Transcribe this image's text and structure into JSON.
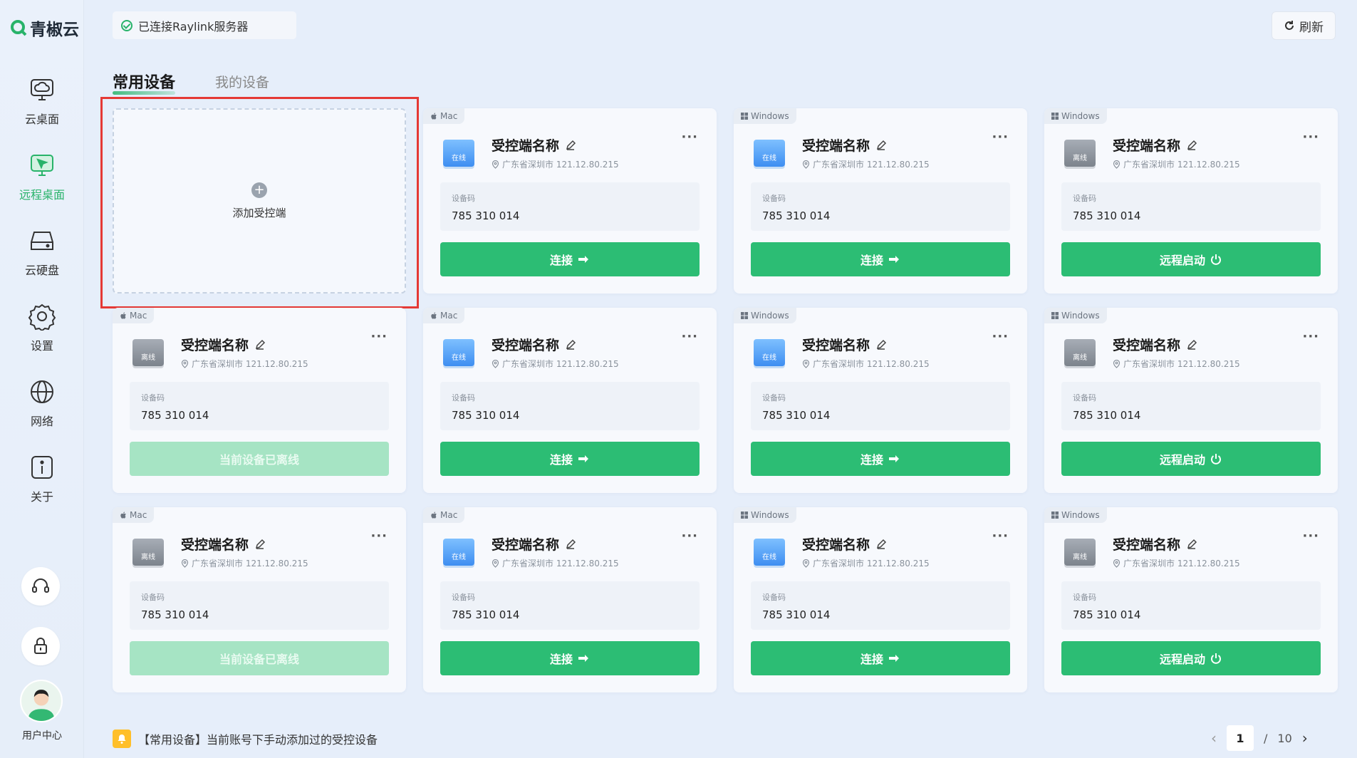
{
  "app": {
    "logo_text": "青椒云"
  },
  "sidebar": {
    "items": [
      {
        "label": "云桌面",
        "icon": "cloud-desktop-icon"
      },
      {
        "label": "远程桌面",
        "icon": "remote-desktop-icon"
      },
      {
        "label": "云硬盘",
        "icon": "cloud-disk-icon"
      },
      {
        "label": "设置",
        "icon": "gear-icon"
      },
      {
        "label": "网络",
        "icon": "globe-icon"
      },
      {
        "label": "关于",
        "icon": "info-icon"
      }
    ],
    "user_center": "用户中心"
  },
  "topbar": {
    "connection_status": "已连接Raylink服务器",
    "refresh_label": "刷新"
  },
  "tabs": {
    "active": "常用设备",
    "inactive": "我的设备"
  },
  "add_tile": {
    "label": "添加受控端"
  },
  "colors": {
    "accent": "#2cbd74",
    "accent_disabled": "#a6e4c4",
    "highlight": "#e53935"
  },
  "devices": [
    {
      "os": "Mac",
      "status": "在线",
      "name": "受控端名称",
      "location": "广东省深圳市 121.12.80.215",
      "code_label": "设备码",
      "code": "785 310 014",
      "action": "连接"
    },
    {
      "os": "Windows",
      "status": "在线",
      "name": "受控端名称",
      "location": "广东省深圳市 121.12.80.215",
      "code_label": "设备码",
      "code": "785 310 014",
      "action": "连接"
    },
    {
      "os": "Windows",
      "status": "离线",
      "name": "受控端名称",
      "location": "广东省深圳市 121.12.80.215",
      "code_label": "设备码",
      "code": "785 310 014",
      "action": "远程启动"
    },
    {
      "os": "Mac",
      "status": "离线",
      "name": "受控端名称",
      "location": "广东省深圳市 121.12.80.215",
      "code_label": "设备码",
      "code": "785 310 014",
      "action": "当前设备已离线"
    },
    {
      "os": "Mac",
      "status": "在线",
      "name": "受控端名称",
      "location": "广东省深圳市 121.12.80.215",
      "code_label": "设备码",
      "code": "785 310 014",
      "action": "连接"
    },
    {
      "os": "Windows",
      "status": "在线",
      "name": "受控端名称",
      "location": "广东省深圳市 121.12.80.215",
      "code_label": "设备码",
      "code": "785 310 014",
      "action": "连接"
    },
    {
      "os": "Windows",
      "status": "离线",
      "name": "受控端名称",
      "location": "广东省深圳市 121.12.80.215",
      "code_label": "设备码",
      "code": "785 310 014",
      "action": "远程启动"
    },
    {
      "os": "Mac",
      "status": "离线",
      "name": "受控端名称",
      "location": "广东省深圳市 121.12.80.215",
      "code_label": "设备码",
      "code": "785 310 014",
      "action": "当前设备已离线"
    },
    {
      "os": "Mac",
      "status": "在线",
      "name": "受控端名称",
      "location": "广东省深圳市 121.12.80.215",
      "code_label": "设备码",
      "code": "785 310 014",
      "action": "连接"
    },
    {
      "os": "Windows",
      "status": "在线",
      "name": "受控端名称",
      "location": "广东省深圳市 121.12.80.215",
      "code_label": "设备码",
      "code": "785 310 014",
      "action": "连接"
    },
    {
      "os": "Windows",
      "status": "离线",
      "name": "受控端名称",
      "location": "广东省深圳市 121.12.80.215",
      "code_label": "设备码",
      "code": "785 310 014",
      "action": "远程启动"
    }
  ],
  "footer": {
    "tip": "【常用设备】当前账号下手动添加过的受控设备",
    "page_current": "1",
    "page_sep": "/",
    "page_total": "10"
  }
}
